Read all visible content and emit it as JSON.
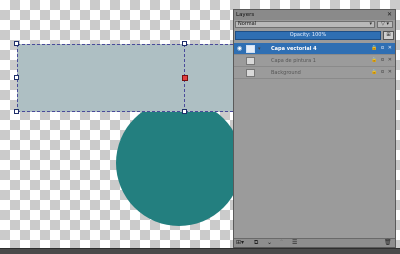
{
  "layers_panel": {
    "title": "Layers",
    "close_icon": "close-icon",
    "blend_mode": "Normal",
    "filter_label": "▽ ▾",
    "opacity_text": "Opacity:  100%",
    "opacity_value": 100,
    "opacity_button_label": "⊞",
    "layers": [
      {
        "name": "Capa vectorial 4",
        "visible": true,
        "selected": true,
        "properties": "🔒 α ✕"
      },
      {
        "name": "Capa de pintura 1",
        "visible": false,
        "selected": false,
        "properties": "🔒 α ✕"
      },
      {
        "name": "Background",
        "visible": false,
        "selected": false,
        "properties": "🔒 α ✕"
      }
    ],
    "toolbar": {
      "add_layer": "⊞▾",
      "duplicate": "⧉",
      "move_down": "⌄",
      "move_up": "⌃",
      "properties": "☰",
      "delete": "🗑"
    }
  },
  "colors": {
    "selection_blue": "#2f6fb3",
    "circle_teal": "#237f7f",
    "rectangle_fill": "#aebfc3",
    "panel_bg": "#9b9b9b"
  }
}
